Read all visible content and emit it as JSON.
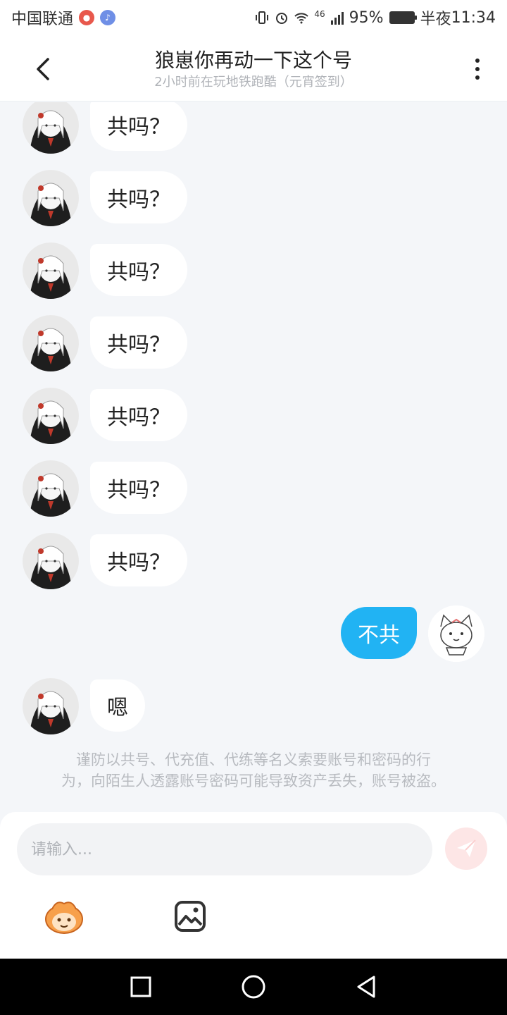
{
  "status_bar": {
    "carrier": "中国联通",
    "network": "46",
    "battery": "95%",
    "time_period": "半夜",
    "time": "11:34"
  },
  "header": {
    "title": "狼崽你再动一下这个号",
    "subtitle": "2小时前在玩地铁跑酷（元宵签到）"
  },
  "messages": [
    {
      "side": "left",
      "text": "共吗？"
    },
    {
      "side": "left",
      "text": "共吗？"
    },
    {
      "side": "left",
      "text": "共吗？"
    },
    {
      "side": "left",
      "text": "共吗？"
    },
    {
      "side": "left",
      "text": "共吗？"
    },
    {
      "side": "left",
      "text": "共吗？"
    },
    {
      "side": "left",
      "text": "共吗？"
    },
    {
      "side": "right",
      "text": "不共"
    },
    {
      "side": "left",
      "text": "嗯"
    }
  ],
  "notice": {
    "line1": "谨防以共号、代充值、代练等名义索要账号和密码的行",
    "line2": "为，向陌生人透露账号密码可能导致资产丢失，账号被盗。"
  },
  "input": {
    "placeholder": "请输入..."
  },
  "icons": {
    "back": "chevron-left-icon",
    "more": "more-vertical-icon",
    "send": "paper-plane-icon",
    "emoji": "emoji-face-icon",
    "image": "image-icon"
  },
  "colors": {
    "accent": "#21b3f3",
    "background": "#f4f6f9",
    "send_button": "#fde6e6"
  }
}
